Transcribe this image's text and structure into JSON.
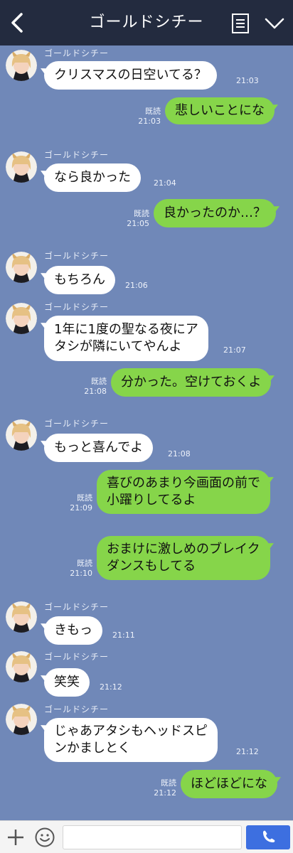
{
  "header": {
    "title": "ゴールドシチー"
  },
  "contact_name": "ゴールドシチー",
  "read_label": "既読",
  "messages": [
    {
      "text": "クリスマスの日空いてる？",
      "time": "21:03"
    },
    {
      "text": "悲しいことにな",
      "time": "21:03"
    },
    {
      "text": "なら良かった",
      "time": "21:04"
    },
    {
      "text": "良かったのか…？",
      "time": "21:05"
    },
    {
      "text": "もちろん",
      "time": "21:06"
    },
    {
      "text_lines": [
        "1年に1度の聖なる夜にア",
        "タシが隣にいてやんよ"
      ],
      "time": "21:07"
    },
    {
      "text": "分かった。空けておくよ",
      "time": "21:08"
    },
    {
      "text": "もっと喜んでよ",
      "time": "21:08"
    },
    {
      "text_lines": [
        "喜びのあまり今画面の前で",
        "小躍りしてるよ"
      ],
      "time": "21:09"
    },
    {
      "text_lines": [
        "おまけに激しめのブレイク",
        "ダンスもしてる"
      ],
      "time": "21:10"
    },
    {
      "text": "きもっ",
      "time": "21:11"
    },
    {
      "text": "笑笑",
      "time": "21:12"
    },
    {
      "text_lines": [
        "じゃあアタシもヘッドスピ",
        "ンかましとく"
      ],
      "time": "21:12"
    },
    {
      "text": "ほどほどにな",
      "time": "21:12"
    }
  ],
  "icons": {
    "back": "chevron-left-icon",
    "menu": "note-list-icon",
    "collapse": "chevron-down-icon",
    "add": "plus-icon",
    "emoji": "smiley-icon",
    "send": "phone-icon",
    "avatar": "avatar-illustration"
  },
  "colors": {
    "header_bg": "#232b3f",
    "chat_bg": "#7088b8",
    "incoming_bubble": "#ffffff",
    "outgoing_bubble": "#86d54a",
    "send_button": "#3d6fe0"
  }
}
